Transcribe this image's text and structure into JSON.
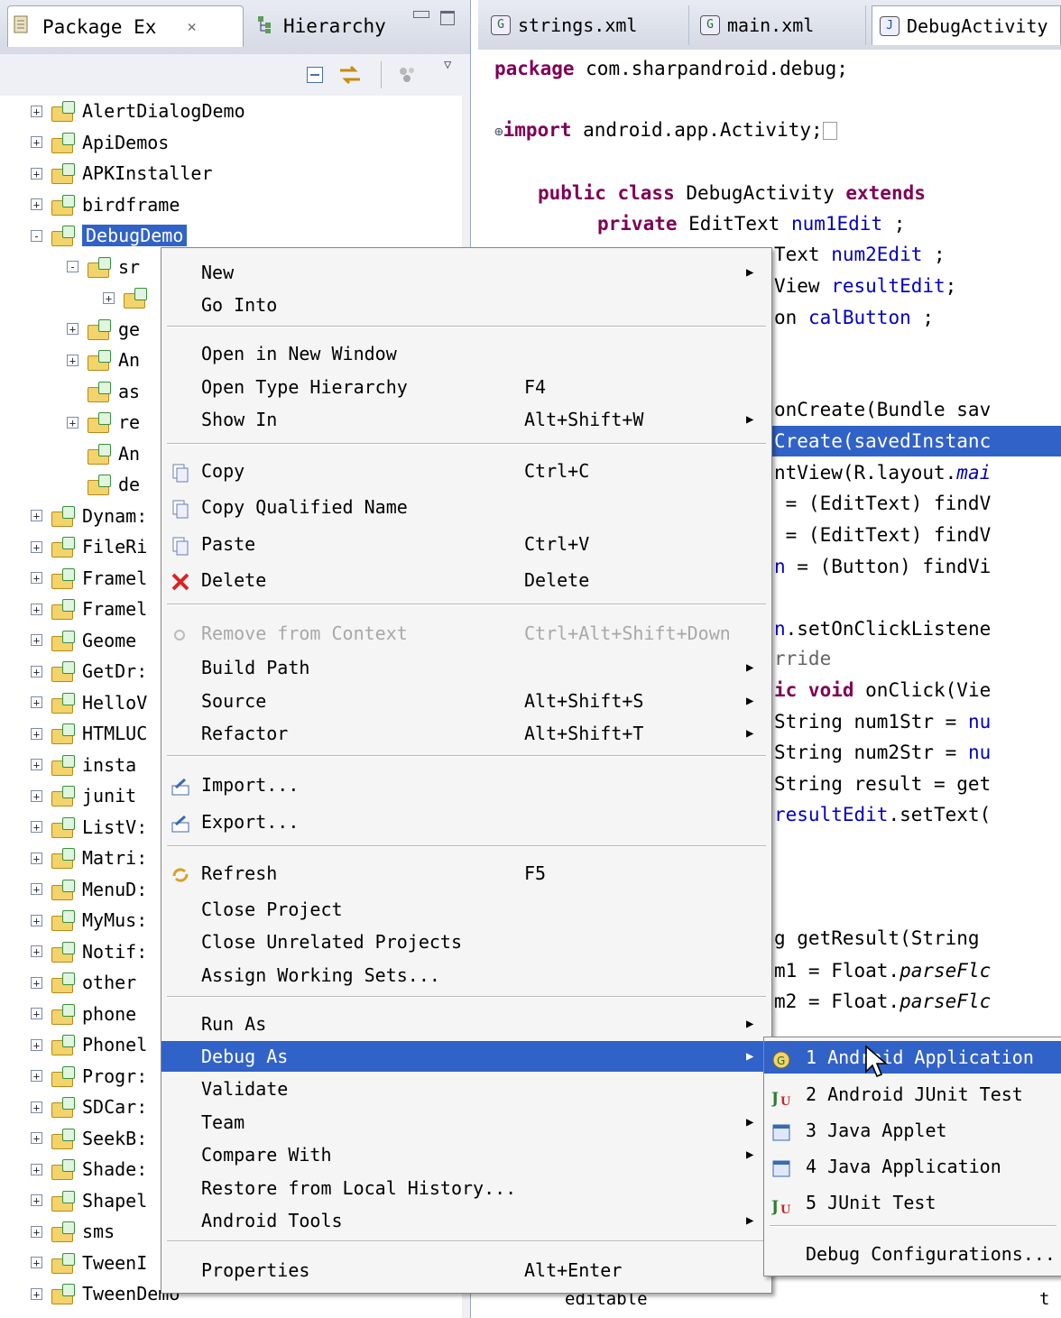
{
  "left_view": {
    "tabs": [
      {
        "label": "Package Ex",
        "icon": "package-explorer-icon",
        "close": "✕"
      },
      {
        "label": "Hierarchy",
        "icon": "hierarchy-icon"
      }
    ],
    "tree": [
      {
        "label": "AlertDialogDemo",
        "expander": "+"
      },
      {
        "label": "ApiDemos",
        "expander": "+"
      },
      {
        "label": "APKInstaller",
        "expander": "+"
      },
      {
        "label": "birdframe",
        "expander": "+"
      },
      {
        "label": "DebugDemo",
        "expander": "-",
        "selected": true
      },
      {
        "label": "sr",
        "expander": "-",
        "indent": 1
      },
      {
        "label": "",
        "expander": "+",
        "indent": 2
      },
      {
        "label": "ge",
        "expander": "+",
        "indent": 1
      },
      {
        "label": "An",
        "expander": "+",
        "indent": 1
      },
      {
        "label": "as",
        "expander": "",
        "indent": 1
      },
      {
        "label": "re",
        "expander": "+",
        "indent": 1
      },
      {
        "label": "An",
        "expander": "",
        "indent": 1
      },
      {
        "label": "de",
        "expander": "",
        "indent": 1
      },
      {
        "label": "Dynam:",
        "expander": "+"
      },
      {
        "label": "FileRi",
        "expander": "+"
      },
      {
        "label": "Framel",
        "expander": "+"
      },
      {
        "label": "Framel",
        "expander": "+"
      },
      {
        "label": "Geome",
        "expander": "+"
      },
      {
        "label": "GetDr:",
        "expander": "+"
      },
      {
        "label": "HelloV",
        "expander": "+"
      },
      {
        "label": "HTMLUC",
        "expander": "+"
      },
      {
        "label": "insta",
        "expander": "+"
      },
      {
        "label": "junit",
        "expander": "+"
      },
      {
        "label": "ListV:",
        "expander": "+"
      },
      {
        "label": "Matri:",
        "expander": "+"
      },
      {
        "label": "MenuD:",
        "expander": "+"
      },
      {
        "label": "MyMus:",
        "expander": "+"
      },
      {
        "label": "Notif:",
        "expander": "+"
      },
      {
        "label": "other",
        "expander": "+"
      },
      {
        "label": "phone",
        "expander": "+"
      },
      {
        "label": "Phonel",
        "expander": "+"
      },
      {
        "label": "Progr:",
        "expander": "+"
      },
      {
        "label": "SDCar:",
        "expander": "+"
      },
      {
        "label": "SeekB:",
        "expander": "+"
      },
      {
        "label": "Shade:",
        "expander": "+"
      },
      {
        "label": "Shapel",
        "expander": "+"
      },
      {
        "label": "sms",
        "expander": "+"
      },
      {
        "label": "TweenI",
        "expander": "+"
      },
      {
        "label": "TweenDemo",
        "expander": "+"
      }
    ]
  },
  "editor": {
    "tabs": [
      {
        "label": "strings.xml",
        "icon": "G"
      },
      {
        "label": "main.xml",
        "icon": "G"
      },
      {
        "label": "DebugActivity",
        "icon": "J"
      }
    ],
    "lines": [
      {
        "text": "  package com.sharpandroid.debug;"
      },
      {
        "text": "⊕import android.app.Activity;□"
      },
      {
        "text": "  public class DebugActivity extends"
      },
      {
        "text": "      private EditText num1Edit ;"
      },
      {
        "text": "Text num2Edit ;"
      },
      {
        "text": "View resultEdit;"
      },
      {
        "text": "on calButton ;"
      },
      {
        "text": "onCreate(Bundle sav"
      },
      {
        "text": "Create(savedInstanc"
      },
      {
        "text": "ntView(R.layout.mai"
      },
      {
        "text": " = (EditText) findV"
      },
      {
        "text": " = (EditText) findV"
      },
      {
        "text": "n = (Button) findVi"
      },
      {
        "text": "n.setOnClickListene"
      },
      {
        "text": "rride"
      },
      {
        "text": "ic void onClick(Vie"
      },
      {
        "text": "String num1Str = nu"
      },
      {
        "text": "String num2Str = nu"
      },
      {
        "text": "String result = get"
      },
      {
        "text": "resultEdit.setText("
      },
      {
        "text": "g getResult(String"
      },
      {
        "text": "m1 = Float.parseFlc"
      },
      {
        "text": "m2 = Float.parseFlc"
      },
      {
        "text": "editable"
      },
      {
        "text": "t"
      }
    ]
  },
  "context_menu": {
    "items": [
      {
        "label": "New",
        "submenu": true
      },
      {
        "label": "Go Into"
      },
      {
        "sep": true
      },
      {
        "label": "Open in New Window"
      },
      {
        "label": "Open Type Hierarchy",
        "accel": "F4"
      },
      {
        "label": "Show In",
        "accel": "Alt+Shift+W",
        "submenu": true
      },
      {
        "sep": true
      },
      {
        "label": "Copy",
        "accel": "Ctrl+C",
        "icon": "copy-icon"
      },
      {
        "label": "Copy Qualified Name",
        "icon": "copy-qualified-name-icon"
      },
      {
        "label": "Paste",
        "accel": "Ctrl+V",
        "icon": "paste-icon"
      },
      {
        "label": "Delete",
        "accel": "Delete",
        "icon": "delete-icon"
      },
      {
        "sep": true
      },
      {
        "label": "Remove from Context",
        "accel": "Ctrl+Alt+Shift+Down",
        "disabled": true,
        "icon": "remove-from-context-icon"
      },
      {
        "label": "Build Path",
        "submenu": true
      },
      {
        "label": "Source",
        "accel": "Alt+Shift+S",
        "submenu": true
      },
      {
        "label": "Refactor",
        "accel": "Alt+Shift+T",
        "submenu": true
      },
      {
        "sep": true
      },
      {
        "label": "Import...",
        "icon": "import-icon"
      },
      {
        "label": "Export...",
        "icon": "export-icon"
      },
      {
        "sep": true
      },
      {
        "label": "Refresh",
        "accel": "F5",
        "icon": "refresh-icon"
      },
      {
        "label": "Close Project"
      },
      {
        "label": "Close Unrelated Projects"
      },
      {
        "label": "Assign Working Sets..."
      },
      {
        "sep": true
      },
      {
        "label": "Run As",
        "submenu": true
      },
      {
        "label": "Debug As",
        "submenu": true,
        "selected": true
      },
      {
        "label": "Validate"
      },
      {
        "label": "Team",
        "submenu": true
      },
      {
        "label": "Compare With",
        "submenu": true
      },
      {
        "label": "Restore from Local History..."
      },
      {
        "label": "Android Tools",
        "submenu": true
      },
      {
        "sep": true
      },
      {
        "label": "Properties",
        "accel": "Alt+Enter"
      }
    ]
  },
  "debug_as_submenu": {
    "items": [
      {
        "label": "1 Android Application",
        "icon": "android-application-icon",
        "selected": true
      },
      {
        "label": "2 Android JUnit Test",
        "icon": "android-junit-icon"
      },
      {
        "label": "3 Java Applet",
        "icon": "java-applet-icon"
      },
      {
        "label": "4 Java Application",
        "icon": "java-application-icon"
      },
      {
        "label": "5 JUnit Test",
        "icon": "junit-icon"
      },
      {
        "sep": true
      },
      {
        "label": "Debug Configurations..."
      }
    ]
  }
}
